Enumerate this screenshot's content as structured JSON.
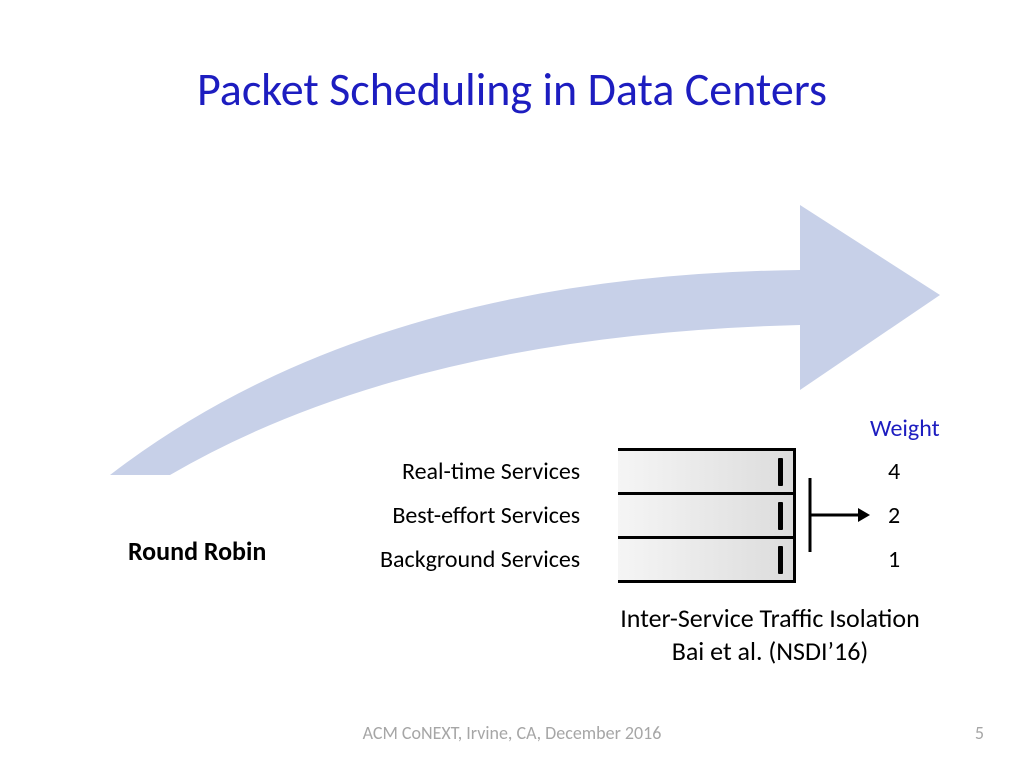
{
  "title": "Packet Scheduling in Data Centers",
  "round_robin": "Round Robin",
  "weight_header": "Weight",
  "services": [
    {
      "label": "Real-time Services",
      "weight": "4"
    },
    {
      "label": "Best-effort Services",
      "weight": "2"
    },
    {
      "label": "Background Services",
      "weight": "1"
    }
  ],
  "caption_line1": "Inter-Service Traffic Isolation",
  "caption_line2": "Bai et al. (NSDI’16)",
  "footer": "ACM CoNEXT, Irvine, CA, December 2016",
  "page_num": "5"
}
